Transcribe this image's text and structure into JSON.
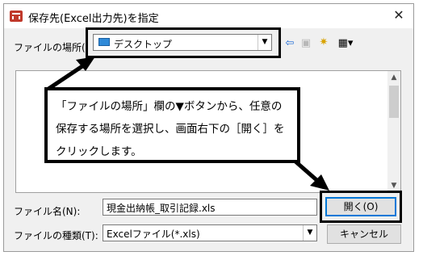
{
  "dialog": {
    "title": "保存先(Excel出力先)を指定",
    "close_glyph": "✕"
  },
  "lookin": {
    "label": "ファイルの場所(I):",
    "value": "デスクトップ",
    "arrow": "▼"
  },
  "toolbar": {
    "back_glyph": "⇦",
    "up_glyph": "▣",
    "newfolder_glyph": "✷",
    "view_glyph": "▦▾"
  },
  "filelist": {
    "scroll_up": "▲",
    "scroll_down": "▼"
  },
  "callout": {
    "lines": [
      "「ファイルの場所」欄の▼ボタンから、任意の",
      "保存する場所を選択し、画面右下の［開く］を",
      "クリックします。"
    ]
  },
  "filename": {
    "label": "ファイル名(N):",
    "value": "現金出納帳_取引記録.xls"
  },
  "filetype": {
    "label": "ファイルの種類(T):",
    "value": "Excelファイル(*.xls)",
    "arrow": "▼"
  },
  "buttons": {
    "open_label": "開く(O)",
    "cancel_label": "キャンセル"
  },
  "colors": {
    "accent": "#0078d7",
    "annotation": "#000000"
  }
}
